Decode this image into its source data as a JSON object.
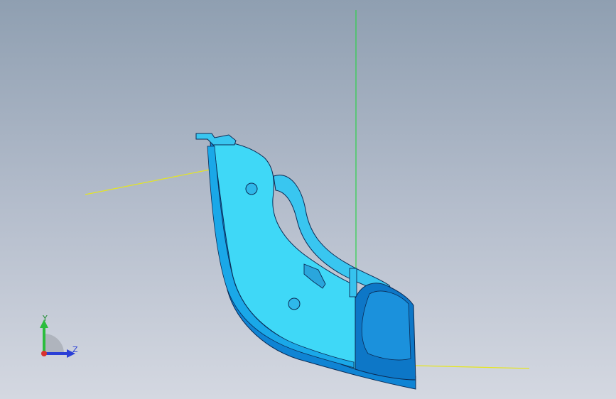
{
  "viewport": {
    "background_top": "#8f9fb1",
    "background_bottom": "#d4d8e1",
    "part_color": "#3fd8f7",
    "part_shadow_color": "#0f84d4",
    "x_axis_color": "#e6e61e",
    "y_axis_color": "#2ed14a"
  },
  "triad": {
    "y_label": "Y",
    "z_label": "Z",
    "y_color": "#2bbd3d",
    "z_color": "#2a3fd6",
    "x_color": "#d9322f"
  }
}
